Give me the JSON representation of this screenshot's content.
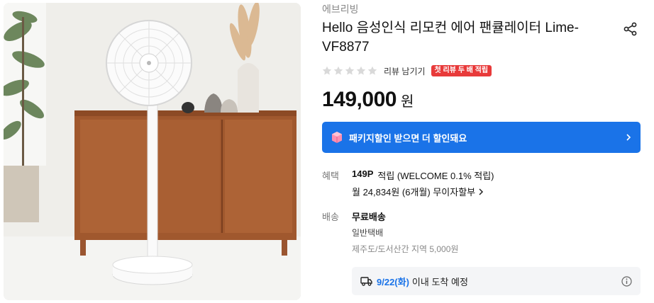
{
  "product": {
    "brand": "에브리빙",
    "title": "Hello 음성인식 리모컨 에어 팬큘레이터 Lime-VF8877",
    "image_alt": "white stand fan beside wooden sideboard"
  },
  "rating": {
    "stars_filled": 0,
    "stars_total": 5,
    "review_link": "리뷰 남기기",
    "review_badge": "첫 리뷰 두 배 적립"
  },
  "price": {
    "amount": "149,000",
    "unit": "원"
  },
  "package_banner": {
    "text": "패키지할인 받으면 더 할인돼요"
  },
  "benefit": {
    "label": "혜택",
    "points": "149P",
    "points_detail": "적립 (WELCOME 0.1% 적립)",
    "installment": "월 24,834원 (6개월) 무이자할부"
  },
  "shipping": {
    "label": "배송",
    "fee": "무료배송",
    "method": "일반택배",
    "extra": "제주도/도서산간 지역 5,000원",
    "arrival_date": "9/22(화)",
    "arrival_text": "이내 도착 예정"
  },
  "colors": {
    "accent": "#1a73e8",
    "badge": "#e83a3a",
    "star_empty": "#d9d9d9"
  }
}
